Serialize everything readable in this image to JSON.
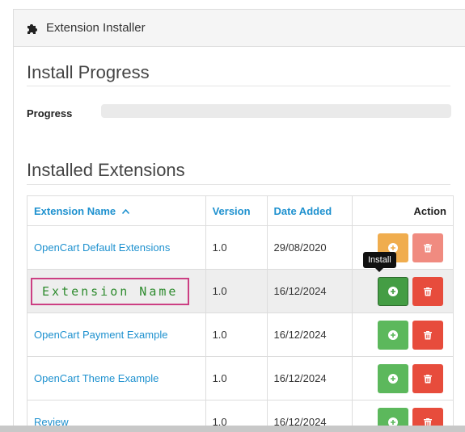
{
  "panel": {
    "title": "Extension Installer",
    "icon": "puzzle-icon"
  },
  "progress_section": {
    "heading": "Install Progress",
    "label": "Progress",
    "value": 0
  },
  "extensions_section": {
    "heading": "Installed Extensions",
    "columns": {
      "name": "Extension Name",
      "version": "Version",
      "date": "Date Added",
      "action": "Action"
    },
    "sort_icon": "caret-up-icon",
    "rows": [
      {
        "name": "OpenCart Default Extensions",
        "version": "1.0",
        "date": "29/08/2020"
      },
      {
        "name": "Extension Name",
        "version": "1.0",
        "date": "16/12/2024"
      },
      {
        "name": "OpenCart Payment Example",
        "version": "1.0",
        "date": "16/12/2024"
      },
      {
        "name": "OpenCart Theme Example",
        "version": "1.0",
        "date": "16/12/2024"
      },
      {
        "name": "Review",
        "version": "1.0",
        "date": "16/12/2024"
      }
    ]
  },
  "tooltip": {
    "text": "Install"
  },
  "colors": {
    "link": "#1e91cf",
    "install": "#5cb85c",
    "uninstall": "#e74c3c",
    "warning": "#f0ad4e",
    "highlight_border": "#cc3f83",
    "highlight_text": "#2e8b2e"
  }
}
